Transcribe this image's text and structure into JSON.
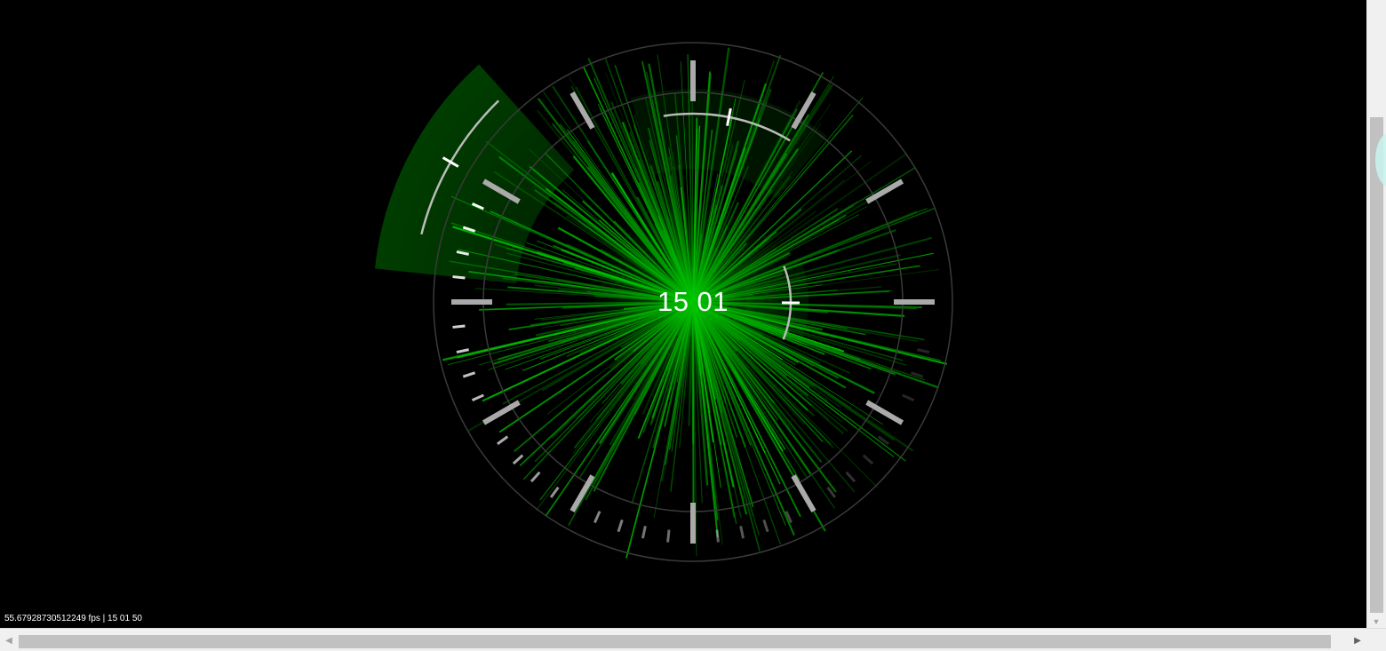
{
  "clock": {
    "time_display": "15 01",
    "hours": 15,
    "minutes": 1,
    "seconds": 50
  },
  "status": {
    "text": "55.67928730512249 fps | 15 01 50"
  },
  "colors": {
    "background": "#000000",
    "accent": "#00b400",
    "ring": "#3a3a3a",
    "tick": "#b0b0b0"
  },
  "icons": {
    "scroll_left": "triangle-left-icon",
    "scroll_right": "triangle-right-icon",
    "scroll_down": "triangle-down-icon"
  },
  "scroll": {
    "left_glyph": "◀",
    "right_glyph": "▶",
    "down_glyph": "▼"
  }
}
